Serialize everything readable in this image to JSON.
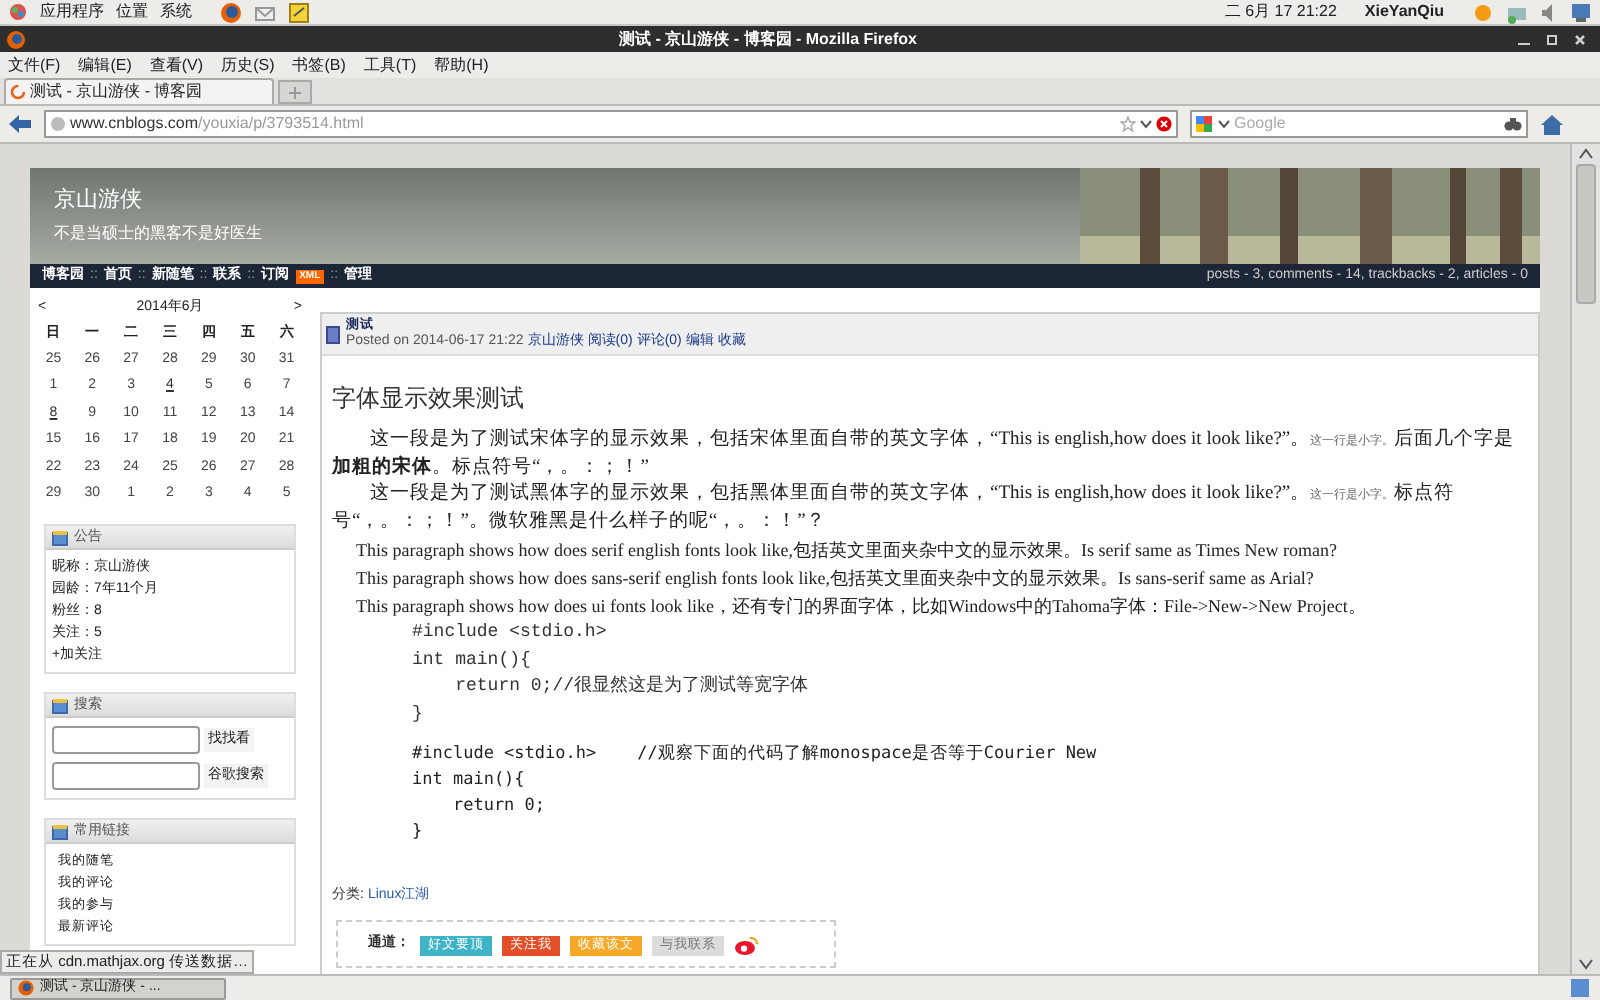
{
  "top_panel": {
    "menus": [
      "应用程序",
      "位置",
      "系统"
    ],
    "clock": "二 6月 17 21:22",
    "user": "XieYanQiu"
  },
  "window": {
    "title": "测试 - 京山游侠 - 博客园 - Mozilla Firefox"
  },
  "menu_bar": [
    "文件(F)",
    "编辑(E)",
    "查看(V)",
    "历史(S)",
    "书签(B)",
    "工具(T)",
    "帮助(H)"
  ],
  "tabs": [
    {
      "label": "测试 - 京山游侠 - 博客园",
      "selected": true
    }
  ],
  "address_bar": {
    "host": "www.cnblogs.com",
    "path": "/youxia/p/3793514.html"
  },
  "search": {
    "placeholder": "Google"
  },
  "blog_header": {
    "title": "京山游侠",
    "subtitle": "不是当硕士的黑客不是好医生"
  },
  "blog_nav": [
    {
      "kind": "link",
      "label": "博客园"
    },
    {
      "kind": "sep",
      "label": "::"
    },
    {
      "kind": "link",
      "label": "首页"
    },
    {
      "kind": "sep",
      "label": "::"
    },
    {
      "kind": "link",
      "label": "新随笔"
    },
    {
      "kind": "sep",
      "label": "::"
    },
    {
      "kind": "link",
      "label": "联系"
    },
    {
      "kind": "sep",
      "label": "::"
    },
    {
      "kind": "link",
      "label": "订阅"
    },
    {
      "kind": "badge",
      "label": "XML"
    },
    {
      "kind": "sep",
      "label": "::"
    },
    {
      "kind": "link",
      "label": "管理"
    }
  ],
  "blog_stats": "posts - 3, comments - 14, trackbacks - 2, articles - 0",
  "calendar": {
    "prev": "<",
    "month": "2014年6月",
    "next": ">",
    "weekdays": [
      "日",
      "一",
      "二",
      "三",
      "四",
      "五",
      "六"
    ],
    "weeks": [
      [
        {
          "day": "25",
          "linked": false
        },
        {
          "day": "26",
          "linked": false
        },
        {
          "day": "27",
          "linked": false
        },
        {
          "day": "28",
          "linked": false
        },
        {
          "day": "29",
          "linked": false
        },
        {
          "day": "30",
          "linked": false
        },
        {
          "day": "31",
          "linked": false
        }
      ],
      [
        {
          "day": "1",
          "linked": false
        },
        {
          "day": "2",
          "linked": false
        },
        {
          "day": "3",
          "linked": false
        },
        {
          "day": "4",
          "linked": true
        },
        {
          "day": "5",
          "linked": false
        },
        {
          "day": "6",
          "linked": false
        },
        {
          "day": "7",
          "linked": false
        }
      ],
      [
        {
          "day": "8",
          "linked": true
        },
        {
          "day": "9",
          "linked": false
        },
        {
          "day": "10",
          "linked": false
        },
        {
          "day": "11",
          "linked": false
        },
        {
          "day": "12",
          "linked": false
        },
        {
          "day": "13",
          "linked": false
        },
        {
          "day": "14",
          "linked": false
        }
      ],
      [
        {
          "day": "15",
          "linked": false
        },
        {
          "day": "16",
          "linked": false
        },
        {
          "day": "17",
          "linked": false
        },
        {
          "day": "18",
          "linked": false
        },
        {
          "day": "19",
          "linked": false
        },
        {
          "day": "20",
          "linked": false
        },
        {
          "day": "21",
          "linked": false
        }
      ],
      [
        {
          "day": "22",
          "linked": false
        },
        {
          "day": "23",
          "linked": false
        },
        {
          "day": "24",
          "linked": false
        },
        {
          "day": "25",
          "linked": false
        },
        {
          "day": "26",
          "linked": false
        },
        {
          "day": "27",
          "linked": false
        },
        {
          "day": "28",
          "linked": false
        }
      ],
      [
        {
          "day": "29",
          "linked": false
        },
        {
          "day": "30",
          "linked": false
        },
        {
          "day": "1",
          "linked": false
        },
        {
          "day": "2",
          "linked": false
        },
        {
          "day": "3",
          "linked": false
        },
        {
          "day": "4",
          "linked": false
        },
        {
          "day": "5",
          "linked": false
        }
      ]
    ]
  },
  "sidebar_boxes": [
    {
      "kind": "lines",
      "title": "公告",
      "lines": [
        "昵称：京山游侠",
        "园龄：7年11个月",
        "粉丝：8",
        "关注：5",
        "+加关注"
      ]
    },
    {
      "kind": "search",
      "title": "搜索",
      "buttons": [
        "找找看",
        "谷歌搜索"
      ]
    },
    {
      "kind": "links",
      "title": "常用链接",
      "lines": [
        "我的随笔",
        "我的评论",
        "我的参与",
        "最新评论"
      ]
    }
  ],
  "post": {
    "title": "测试",
    "meta": "Posted on 2014-06-17 21:22",
    "meta_links": [
      "京山游侠",
      "阅读(0)",
      "评论(0)",
      "编辑",
      "收藏"
    ],
    "heading": "字体显示效果测试",
    "paragraphs": [
      {
        "kind": "small_note",
        "before": "这一段是为了测试宋体字的显示效果，包括宋体里面自带的英文字体，“This is english,how does it look like?”。",
        "note": "这一行是小字。",
        "after": "后面几个字是**加粗的宋体**。标点符号“，。：；！”"
      },
      {
        "kind": "small_note",
        "before": "这一段是为了测试黑体字的显示效果，包括黑体里面自带的英文字体，“This is english,how does it look like?”。",
        "note": "这一行是小字。",
        "after": "标点符号“，。：；！”。微软雅黑是什么样子的呢“，。：！”？"
      },
      {
        "kind": "plain",
        "text": "This paragraph shows how does serif english fonts look like,包括英文里面夹杂中文的显示效果。Is serif same as Times New roman?"
      },
      {
        "kind": "plain",
        "text": "This paragraph shows how does sans-serif english fonts look like,包括英文里面夹杂中文的显示效果。Is sans-serif same as Arial?"
      },
      {
        "kind": "plain",
        "text": "This paragraph shows how does ui fonts look like，还有专门的界面字体，比如Windows中的Tahoma字体：File->New->New Project。"
      }
    ],
    "code_blocks": [
      {
        "kind": "serif",
        "lines": [
          "#include <stdio.h>",
          "int main(){",
          "    return 0;//很显然这是为了测试等宽字体",
          "}"
        ]
      },
      {
        "kind": "mono",
        "lines": [
          "#include <stdio.h>    //观察下面的代码了解monospace是否等于Courier New",
          "int main(){",
          "    return 0;",
          "}"
        ]
      }
    ],
    "category_label": "分类:",
    "category": "Linux江湖",
    "share_label": "通道：",
    "share_buttons": [
      {
        "label": "好文要顶",
        "color": "#3fb4c6",
        "disabled": false
      },
      {
        "label": "关注我",
        "color": "#e2502a",
        "disabled": false
      },
      {
        "label": "收藏该文",
        "color": "#f6a828",
        "disabled": false
      },
      {
        "label": "与我联系",
        "color": "#dcdcdc",
        "disabled": true
      }
    ]
  },
  "status_bar": "正在从 cdn.mathjax.org 传送数据…",
  "taskbar": [
    {
      "label": "测试 - 京山游侠 - ...",
      "selected": true
    }
  ]
}
